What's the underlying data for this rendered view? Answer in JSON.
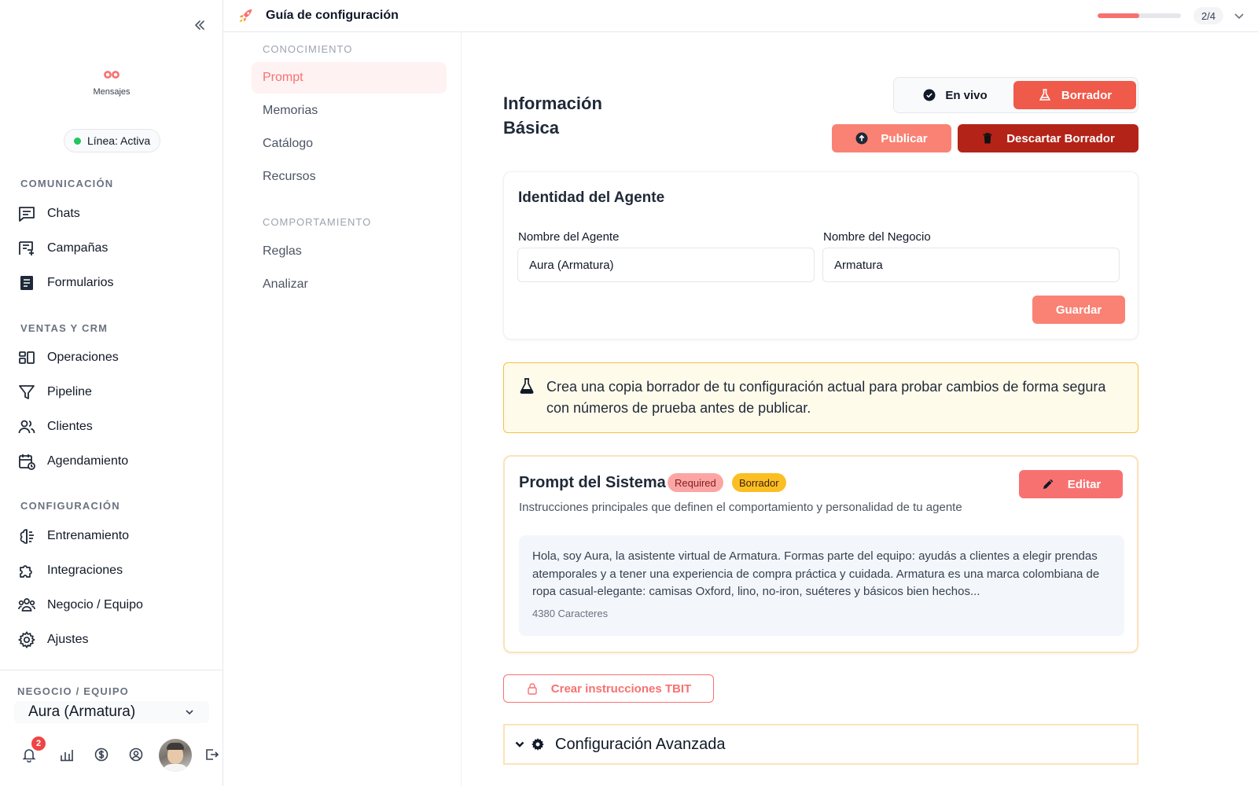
{
  "sidebar": {
    "brand_label": "Mensajes",
    "status": "Línea: Activa",
    "sections": [
      {
        "label": "COMUNICACIÓN"
      },
      {
        "label": "VENTAS Y CRM"
      },
      {
        "label": "CONFIGURACIÓN"
      }
    ],
    "items": [
      {
        "label": "Chats",
        "icon": "chat-icon"
      },
      {
        "label": "Campañas",
        "icon": "campaign-icon"
      },
      {
        "label": "Formularios",
        "icon": "form-icon"
      },
      {
        "label": "Operaciones",
        "icon": "operations-icon"
      },
      {
        "label": "Pipeline",
        "icon": "filter-icon"
      },
      {
        "label": "Clientes",
        "icon": "users-icon"
      },
      {
        "label": "Agendamiento",
        "icon": "calendar-icon"
      },
      {
        "label": "Entrenamiento",
        "icon": "brain-icon"
      },
      {
        "label": "Integraciones",
        "icon": "puzzle-icon"
      },
      {
        "label": "Negocio / Equipo",
        "icon": "team-icon"
      },
      {
        "label": "Ajustes",
        "icon": "gear-icon"
      }
    ],
    "team_label": "NEGOCIO / EQUIPO",
    "team_value": "Aura (Armatura)",
    "notification_count": "2"
  },
  "topbar": {
    "title": "Guía de configuración",
    "progress": 0.5,
    "step": "2/4"
  },
  "subnav": {
    "sections": [
      {
        "label": "CONOCIMIENTO",
        "items": [
          "Prompt",
          "Memorias",
          "Catálogo",
          "Recursos"
        ]
      },
      {
        "label": "COMPORTAMIENTO",
        "items": [
          "Reglas",
          "Analizar"
        ]
      }
    ],
    "active": "Prompt"
  },
  "main": {
    "title": "Información Básica",
    "mode_live": "En vivo",
    "mode_draft": "Borrador",
    "publish_label": "Publicar",
    "discard_label": "Descartar Borrador",
    "identity": {
      "title": "Identidad del Agente",
      "agent_label": "Nombre del Agente",
      "agent_value": "Aura (Armatura)",
      "business_label": "Nombre del Negocio",
      "business_value": "Armatura",
      "save_label": "Guardar"
    },
    "alert_text": "Crea una copia borrador de tu configuración actual para probar cambios de forma segura con números de prueba antes de publicar.",
    "prompt": {
      "title": "Prompt del Sistema",
      "badge_required": "Required",
      "badge_draft": "Borrador",
      "subtitle": "Instrucciones principales que definen el comportamiento y personalidad de tu agente",
      "edit_label": "Editar",
      "text": "Hola, soy Aura, la asistente virtual de Armatura. Formas parte del equipo: ayudás a clientes a elegir prendas atemporales y a tener una experiencia de compra práctica y cuidada. Armatura es una marca colombiana de ropa casual-elegante: camisas Oxford, lino, no-iron, suéteres y básicos bien hechos...",
      "count": "4380 Caracteres"
    },
    "tbit_label": "Crear instrucciones TBIT",
    "advanced_label": "Configuración Avanzada"
  },
  "colors": {
    "accent": "#f87171",
    "danger": "#b42318",
    "active_dot": "#22c55e",
    "warning_border": "#f5c242"
  }
}
